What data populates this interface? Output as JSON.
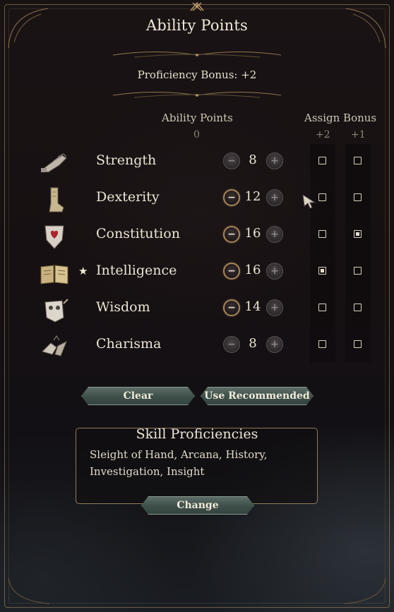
{
  "panel": {
    "title": "Ability Points",
    "proficiency_label": "Proficiency Bonus: +2"
  },
  "headers": {
    "ability_points": "Ability Points",
    "points_remaining": "0",
    "assign_bonus": "Assign Bonus",
    "plus_two": "+2",
    "plus_one": "+1"
  },
  "abilities": [
    {
      "name": "Strength",
      "score": "8",
      "icon": "gauntlet-icon",
      "starred": false,
      "minus_enabled": false,
      "bonus2": false,
      "bonus1": false
    },
    {
      "name": "Dexterity",
      "score": "12",
      "icon": "boot-icon",
      "starred": false,
      "minus_enabled": true,
      "bonus2": false,
      "bonus1": false
    },
    {
      "name": "Constitution",
      "score": "16",
      "icon": "heart-shield-icon",
      "starred": false,
      "minus_enabled": true,
      "bonus2": false,
      "bonus1": true
    },
    {
      "name": "Intelligence",
      "score": "16",
      "icon": "open-book-icon",
      "starred": true,
      "minus_enabled": true,
      "bonus2": true,
      "bonus1": false
    },
    {
      "name": "Wisdom",
      "score": "14",
      "icon": "owl-icon",
      "starred": false,
      "minus_enabled": true,
      "bonus2": false,
      "bonus1": false
    },
    {
      "name": "Charisma",
      "score": "8",
      "icon": "hands-icon",
      "starred": false,
      "minus_enabled": false,
      "bonus2": false,
      "bonus1": false
    }
  ],
  "star_glyph": "★",
  "buttons": {
    "clear": "Clear",
    "use_recommended": "Use Recommended",
    "change": "Change"
  },
  "skills": {
    "title": "Skill Proficiencies",
    "list": "Sleight of Hand, Arcana, History, Investigation, Insight"
  },
  "colors": {
    "gold": "#b99a6b",
    "button_teal": "#3e4f4a",
    "text": "#ece4d4"
  }
}
